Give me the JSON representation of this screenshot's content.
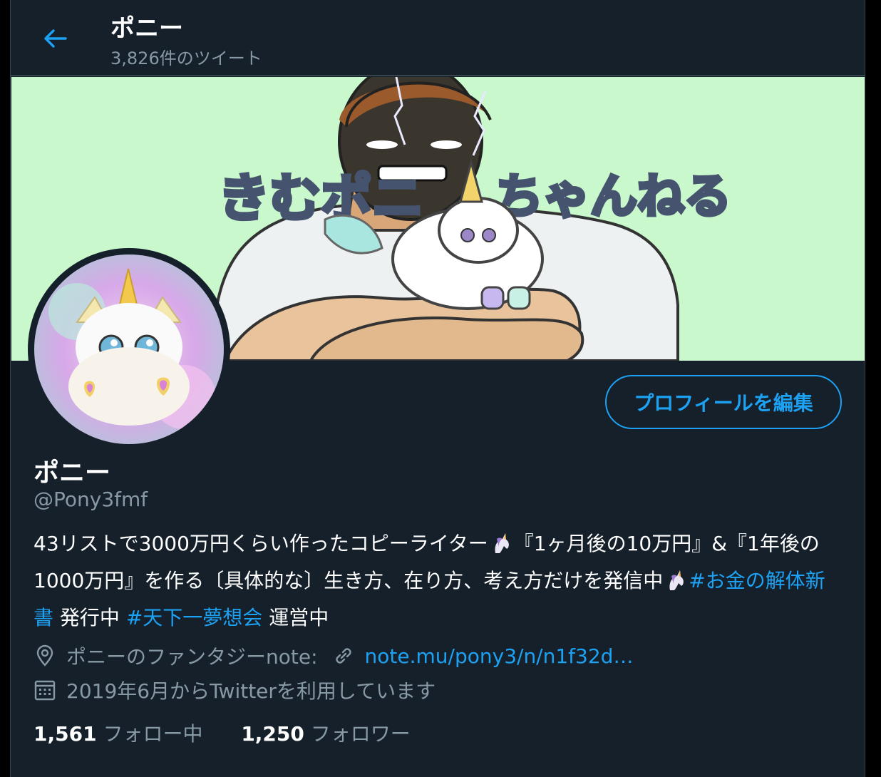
{
  "header": {
    "title": "ポニー",
    "tweet_count": "3,826件のツイート"
  },
  "banner": {
    "text_left": "きむポニ",
    "text_right": "ちゃんねる"
  },
  "profile": {
    "edit_button": "プロフィールを編集",
    "name": "ポニー",
    "handle": "@Pony3fmf",
    "bio": {
      "part1": "43リストで3000万円くらい作ったコピーライター",
      "part2": "『1ヶ月後の10万円』&『1年後の1000万円』を作る〔具体的な〕生き方、在り方、考え方だけを発信中",
      "tag1": "#お金の解体新書",
      "part3": " 発行中 ",
      "tag2": "#天下一夢想会",
      "part4": " 運営中"
    },
    "location": "ポニーのファンタジーnote:",
    "link": "note.mu/pony3/n/n1f32d…",
    "joined": "2019年6月からTwitterを利用しています",
    "following_count": "1,561",
    "following_label": "フォロー中",
    "followers_count": "1,250",
    "followers_label": "フォロワー"
  },
  "icons": [
    "back-arrow-icon",
    "location-pin-icon",
    "link-icon",
    "calendar-icon",
    "unicorn-emoji-icon"
  ],
  "colors": {
    "accent": "#1da1f2",
    "background": "#15202b",
    "muted": "#8899a6",
    "banner_bg": "#c9f8cc"
  }
}
